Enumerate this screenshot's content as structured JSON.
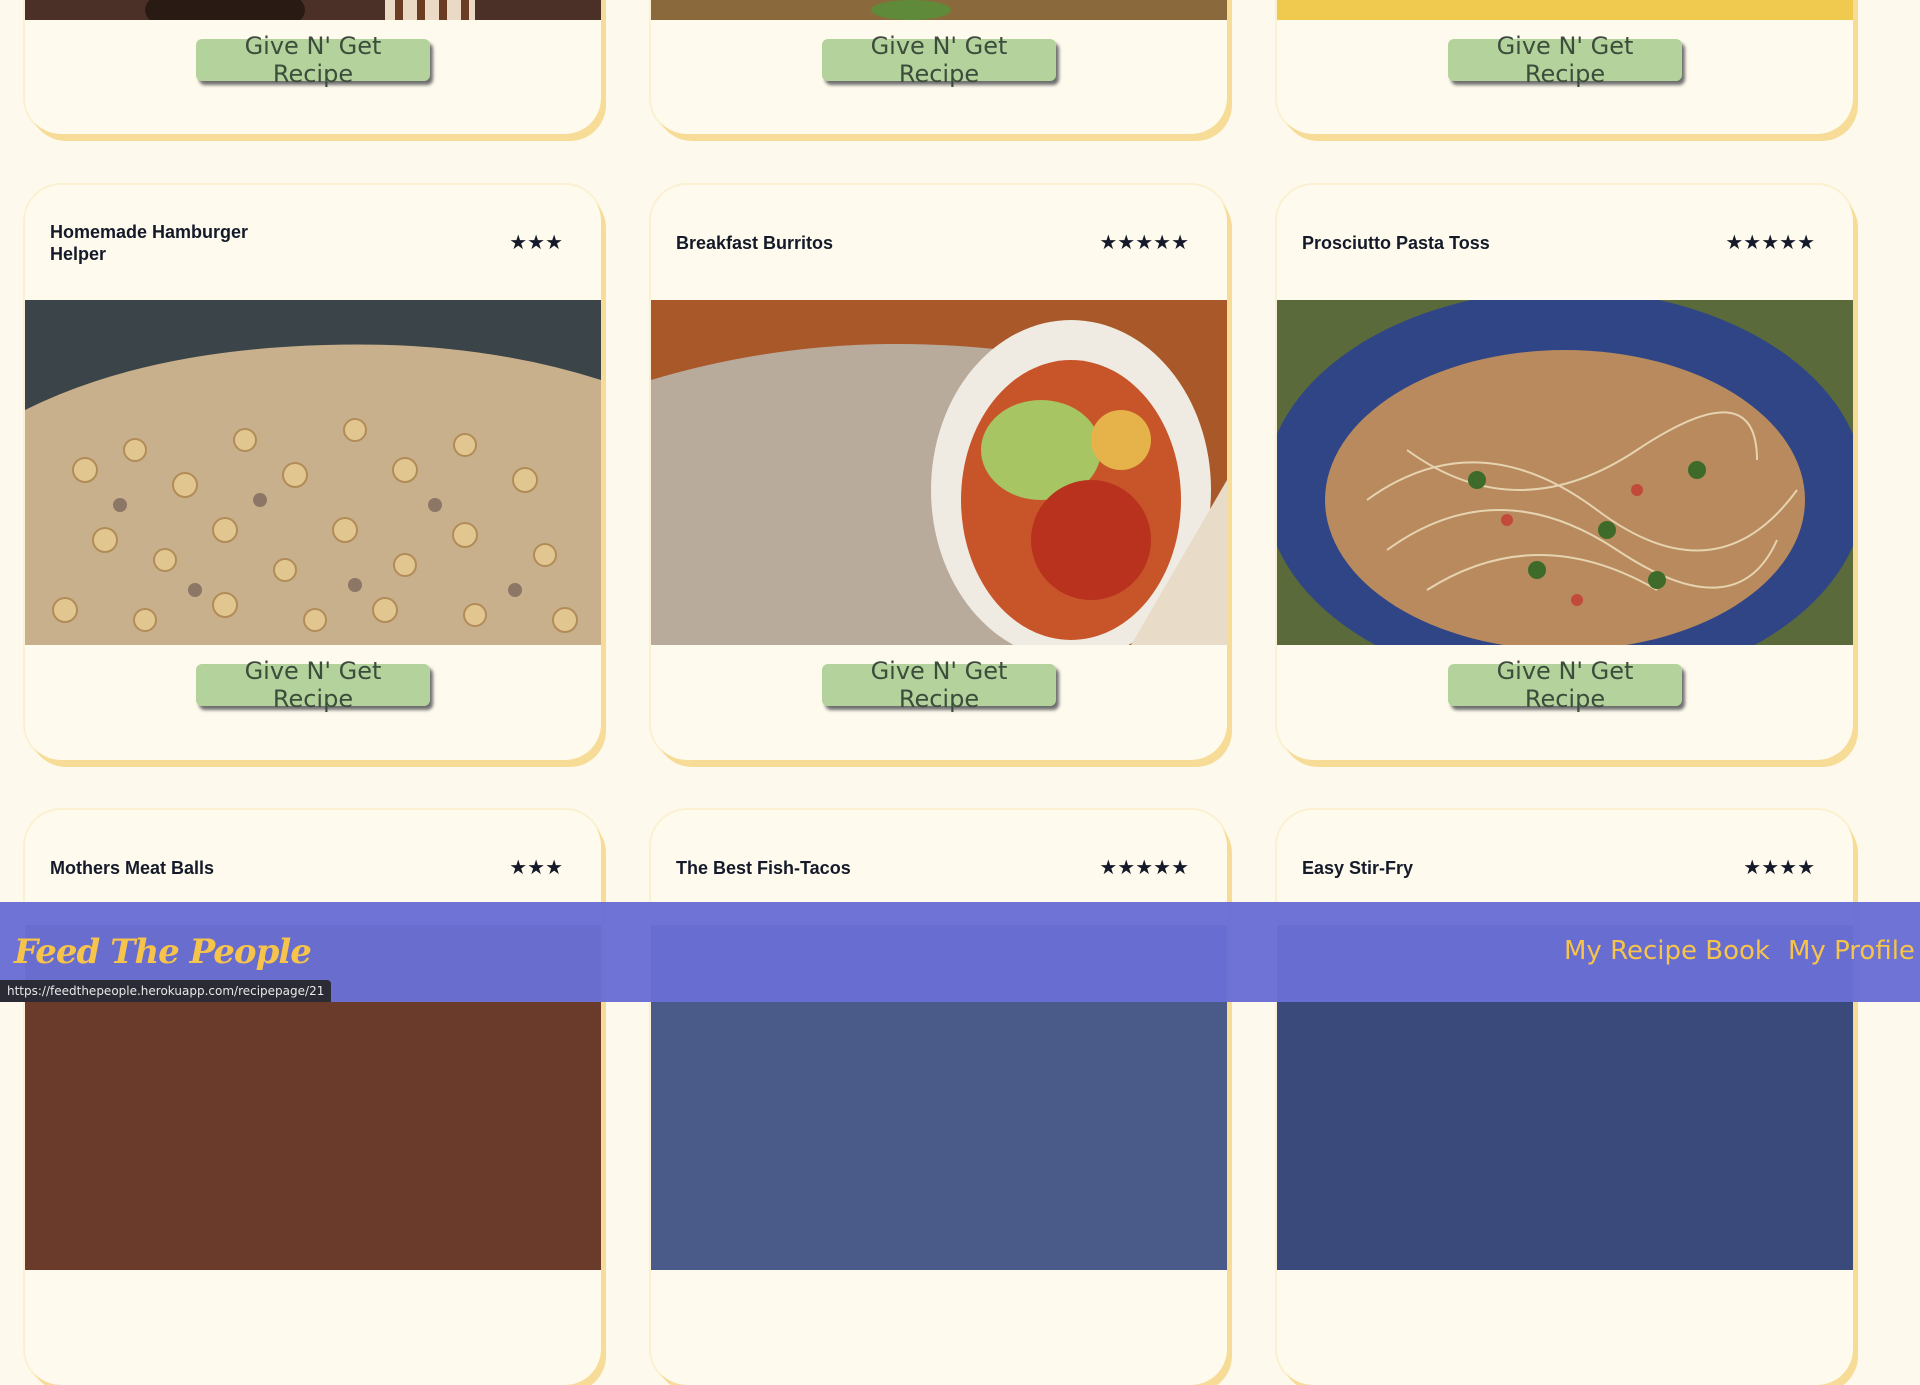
{
  "button_label": "Give N' Get Recipe",
  "rows": [
    {
      "cards": [
        {
          "title": "",
          "stars": ""
        },
        {
          "title": "",
          "stars": ""
        },
        {
          "title": "",
          "stars": ""
        }
      ]
    },
    {
      "cards": [
        {
          "title": "Homemade Hamburger Helper",
          "stars": "★★★"
        },
        {
          "title": "Breakfast Burritos",
          "stars": "★★★★★"
        },
        {
          "title": "Prosciutto Pasta Toss",
          "stars": "★★★★★"
        }
      ]
    },
    {
      "cards": [
        {
          "title": "Mothers Meat Balls",
          "stars": "★★★"
        },
        {
          "title": "The Best Fish-Tacos",
          "stars": "★★★★★"
        },
        {
          "title": "Easy Stir-Fry",
          "stars": "★★★★"
        }
      ]
    }
  ],
  "navbar": {
    "logo": "Feed The People",
    "links": [
      "My Recipe Book",
      "My Profile"
    ]
  },
  "status_url": "https://feedthepeople.herokuapp.com/recipepage/21",
  "colors": {
    "background": "#fdf9ec",
    "button": "#b4d39c",
    "nav": "#696ed4",
    "accent": "#f6c44a"
  }
}
